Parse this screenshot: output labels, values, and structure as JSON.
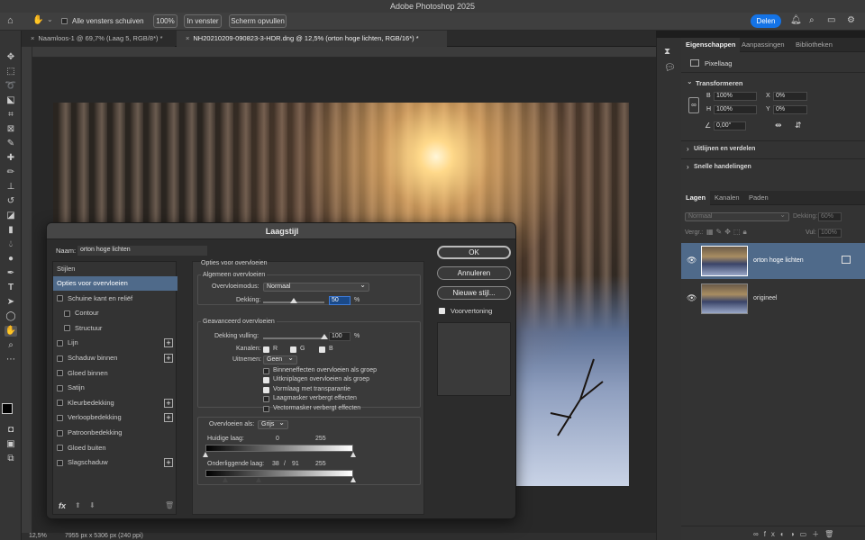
{
  "app": {
    "title": "Adobe Photoshop 2025",
    "share_label": "Delen"
  },
  "options_bar": {
    "scroll_all": "Alle vensters schuiven",
    "zoom_100": "100%",
    "fit_window": "In venster",
    "fill_screen": "Scherm opvullen"
  },
  "doc_tabs": [
    {
      "label": "Naamloos-1 @ 69,7% (Laag 5, RGB/8*) *"
    },
    {
      "label": "NH20210209-090823-3-HDR.dng @ 12,5% (orton hoge lichten, RGB/16*) *"
    }
  ],
  "status": {
    "zoom": "12,5%",
    "doc_size": "7955 px x 5306 px (240 ppi)"
  },
  "properties": {
    "tabs": [
      "Eigenschappen",
      "Aanpassingen",
      "Bibliotheken"
    ],
    "kind": "Pixellaag",
    "transform_title": "Transformeren",
    "w_label": "B",
    "w_value": "100%",
    "h_label": "H",
    "h_value": "100%",
    "x_label": "X",
    "x_value": "0%",
    "y_label": "Y",
    "y_value": "0%",
    "angle_value": "0,00°",
    "align_section": "Uitlijnen en verdelen",
    "quick_actions": "Snelle handelingen"
  },
  "layers_panel": {
    "tabs": [
      "Lagen",
      "Kanalen",
      "Paden"
    ],
    "blend_mode": "Normaal",
    "opacity_label": "Dekking:",
    "opacity_value": "60%",
    "lock_label": "Vergr.:",
    "fill_label": "Vul:",
    "fill_value": "100%",
    "layers": [
      {
        "name": "orton hoge lichten",
        "selected": true
      },
      {
        "name": "origineel",
        "selected": false
      }
    ]
  },
  "dialog": {
    "title": "Laagstijl",
    "name_label": "Naam:",
    "name_value": "orton hoge lichten",
    "styles_header": "Stijlen",
    "styles": [
      {
        "label": "Opties voor overvloeien",
        "checkbox": false,
        "plus": false,
        "selected": true,
        "indent": false
      },
      {
        "label": "Schuine kant en reliëf",
        "checkbox": true,
        "plus": false,
        "indent": false
      },
      {
        "label": "Contour",
        "checkbox": true,
        "plus": false,
        "indent": true
      },
      {
        "label": "Structuur",
        "checkbox": true,
        "plus": false,
        "indent": true
      },
      {
        "label": "Lijn",
        "checkbox": true,
        "plus": true,
        "indent": false
      },
      {
        "label": "Schaduw binnen",
        "checkbox": true,
        "plus": true,
        "indent": false
      },
      {
        "label": "Gloed binnen",
        "checkbox": true,
        "plus": false,
        "indent": false
      },
      {
        "label": "Satijn",
        "checkbox": true,
        "plus": false,
        "indent": false
      },
      {
        "label": "Kleurbedekking",
        "checkbox": true,
        "plus": true,
        "indent": false
      },
      {
        "label": "Verloopbedekking",
        "checkbox": true,
        "plus": true,
        "indent": false
      },
      {
        "label": "Patroonbedekking",
        "checkbox": true,
        "plus": false,
        "indent": false
      },
      {
        "label": "Gloed buiten",
        "checkbox": true,
        "plus": false,
        "indent": false
      },
      {
        "label": "Slagschaduw",
        "checkbox": true,
        "plus": true,
        "indent": false
      }
    ],
    "fx_label": "fx",
    "options_title": "Opties voor overvloeien",
    "general_title": "Algemeen overvloeien",
    "blend_mode_label": "Overvloeimodus:",
    "blend_mode_value": "Normaal",
    "opacity_label": "Dekking:",
    "opacity_value": "50",
    "opacity_level": 50,
    "percent": "%",
    "advanced_title": "Geavanceerd overvloeien",
    "fill_opacity_label": "Dekking vulling:",
    "fill_opacity_value": "100",
    "fill_level": 100,
    "channels_label": "Kanalen:",
    "channel_r": "R",
    "channel_g": "G",
    "channel_b": "B",
    "knockout_label": "Uitnemen:",
    "knockout_value": "Geen",
    "adv_options": [
      {
        "label": "Binneneffecten overvloeien als groep",
        "checked": false
      },
      {
        "label": "Uitkniplagen overvloeien als groep",
        "checked": true
      },
      {
        "label": "Vormlaag met transparantie",
        "checked": true
      },
      {
        "label": "Laagmasker verbergt effecten",
        "checked": false
      },
      {
        "label": "Vectormasker verbergt effecten",
        "checked": false
      }
    ],
    "blend_if_label": "Overvloeien als:",
    "blend_if_value": "Grijs",
    "this_layer_label": "Huidige laag:",
    "this_layer_low": "0",
    "this_layer_high": "255",
    "underlying_label": "Onderliggende laag:",
    "underlying_low": "38",
    "underlying_sep": "/",
    "underlying_mid": "91",
    "underlying_high": "255",
    "ok": "OK",
    "cancel": "Annuleren",
    "new_style": "Nieuwe stijl...",
    "preview": "Voorvertoning"
  }
}
